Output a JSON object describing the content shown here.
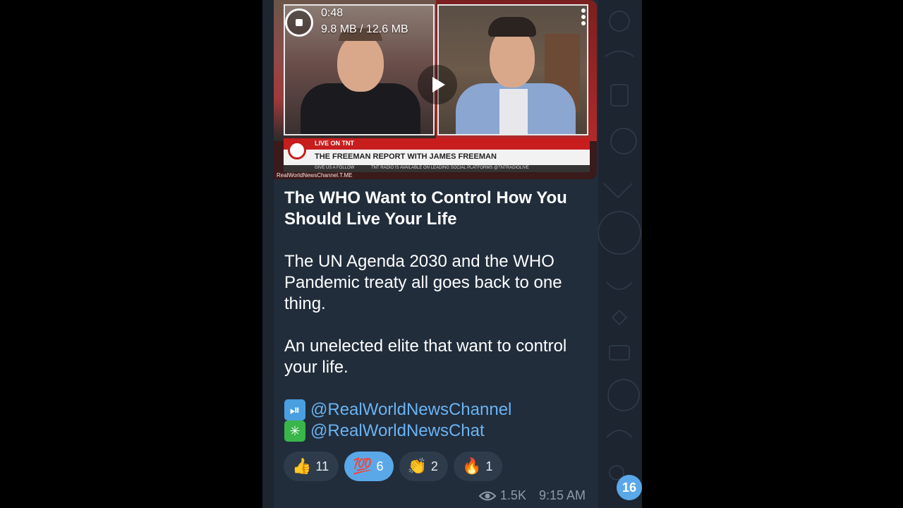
{
  "video": {
    "duration": "0:48",
    "download_progress": "9.8 MB / 12.6 MB",
    "broadcast": {
      "live_label": "LIVE ON TNT",
      "show_title": "THE FREEMAN REPORT WITH JAMES FREEMAN",
      "ticker_left": "GIVE US A FOLLOW",
      "ticker_right": "TNT RADIO IS AVAILABLE ON LEADING SOCIAL PLATFORMS @TNTRADIOLIVE",
      "watermark": "RealWorldNewsChannel.T.ME"
    }
  },
  "post": {
    "title": "The WHO Want to Control How You Should Live Your Life",
    "paragraph1": "The UN Agenda 2030 and the WHO Pandemic treaty all goes back to one thing.",
    "paragraph2": "An unelected elite that want to control your life.",
    "links": [
      {
        "icon": "play-pause-icon",
        "emoji": "⏯",
        "text": "@RealWorldNewsChannel"
      },
      {
        "icon": "asterisk-icon",
        "emoji": "✳",
        "text": "@RealWorldNewsChat"
      }
    ]
  },
  "reactions": [
    {
      "emoji": "👍",
      "icon": "thumbs-up-icon",
      "count": "11",
      "active": false
    },
    {
      "emoji": "💯",
      "icon": "hundred-points-icon",
      "count": "6",
      "active": true
    },
    {
      "emoji": "👏",
      "icon": "clapping-hands-icon",
      "count": "2",
      "active": false
    },
    {
      "emoji": "🔥",
      "icon": "fire-icon",
      "count": "1",
      "active": false
    }
  ],
  "meta": {
    "views": "1.5K",
    "time": "9:15 AM"
  },
  "unread_badge": "16",
  "colors": {
    "background": "#1c2530",
    "bubble": "#212d3b",
    "link": "#6ab3f3",
    "accent": "#5ba8e8",
    "meta_text": "#8c9aa8"
  }
}
